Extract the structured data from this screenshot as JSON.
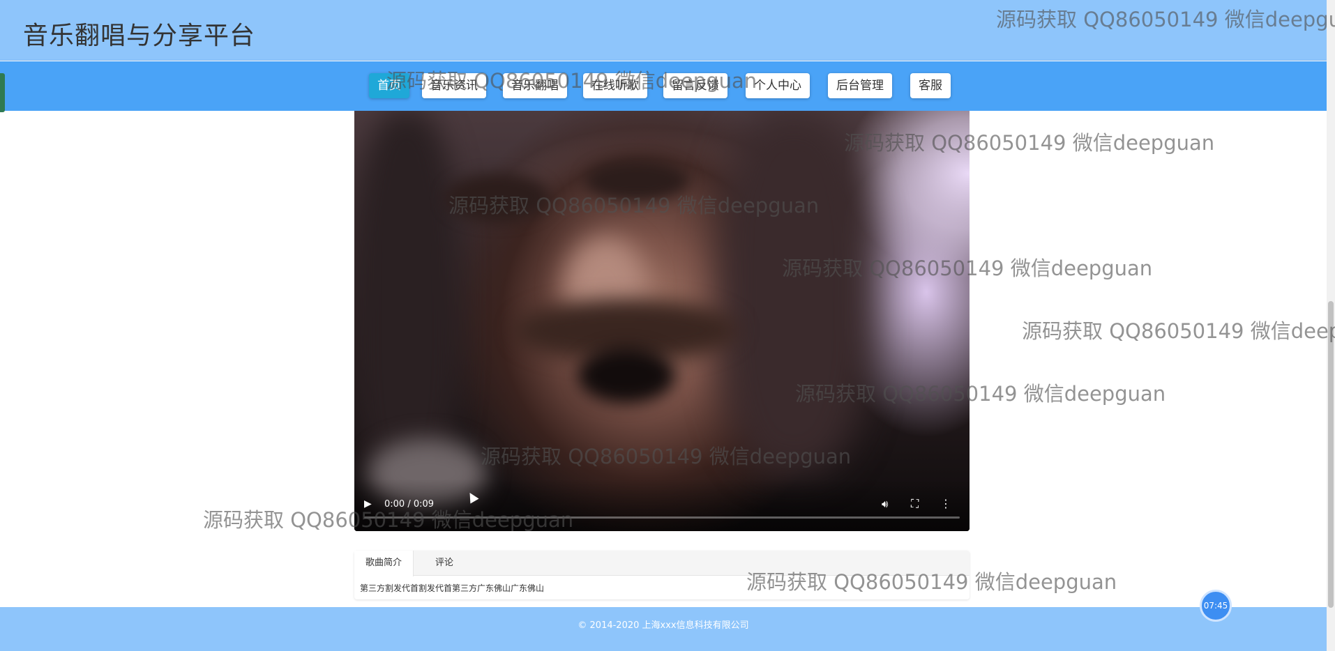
{
  "site": {
    "title": "音乐翻唱与分享平台"
  },
  "nav": {
    "items": [
      {
        "label": "首页",
        "active": true
      },
      {
        "label": "音乐资讯",
        "active": false
      },
      {
        "label": "音乐翻唱",
        "active": false
      },
      {
        "label": "在线听歌",
        "active": false
      },
      {
        "label": "留言反馈",
        "active": false
      },
      {
        "label": "个人中心",
        "active": false
      },
      {
        "label": "后台管理",
        "active": false
      },
      {
        "label": "客服",
        "active": false
      }
    ]
  },
  "video": {
    "time_display": "0:00 / 0:09",
    "progress": 0,
    "icons": {
      "play": "play-icon",
      "volume": "volume-icon",
      "fullscreen": "fullscreen-icon",
      "more": "more-options-icon"
    }
  },
  "tabs": {
    "items": [
      {
        "label": "歌曲简介",
        "active": true
      },
      {
        "label": "评论",
        "active": false
      }
    ],
    "content": "第三方割发代首割发代首第三方广东佛山广东佛山"
  },
  "footer": {
    "copyright": "© 2014-2020 上海xxx信息科技有限公司"
  },
  "clock_badge": {
    "time": "07:45"
  },
  "watermark": {
    "text": "源码获取 QQ86050149 微信deepguan"
  }
}
